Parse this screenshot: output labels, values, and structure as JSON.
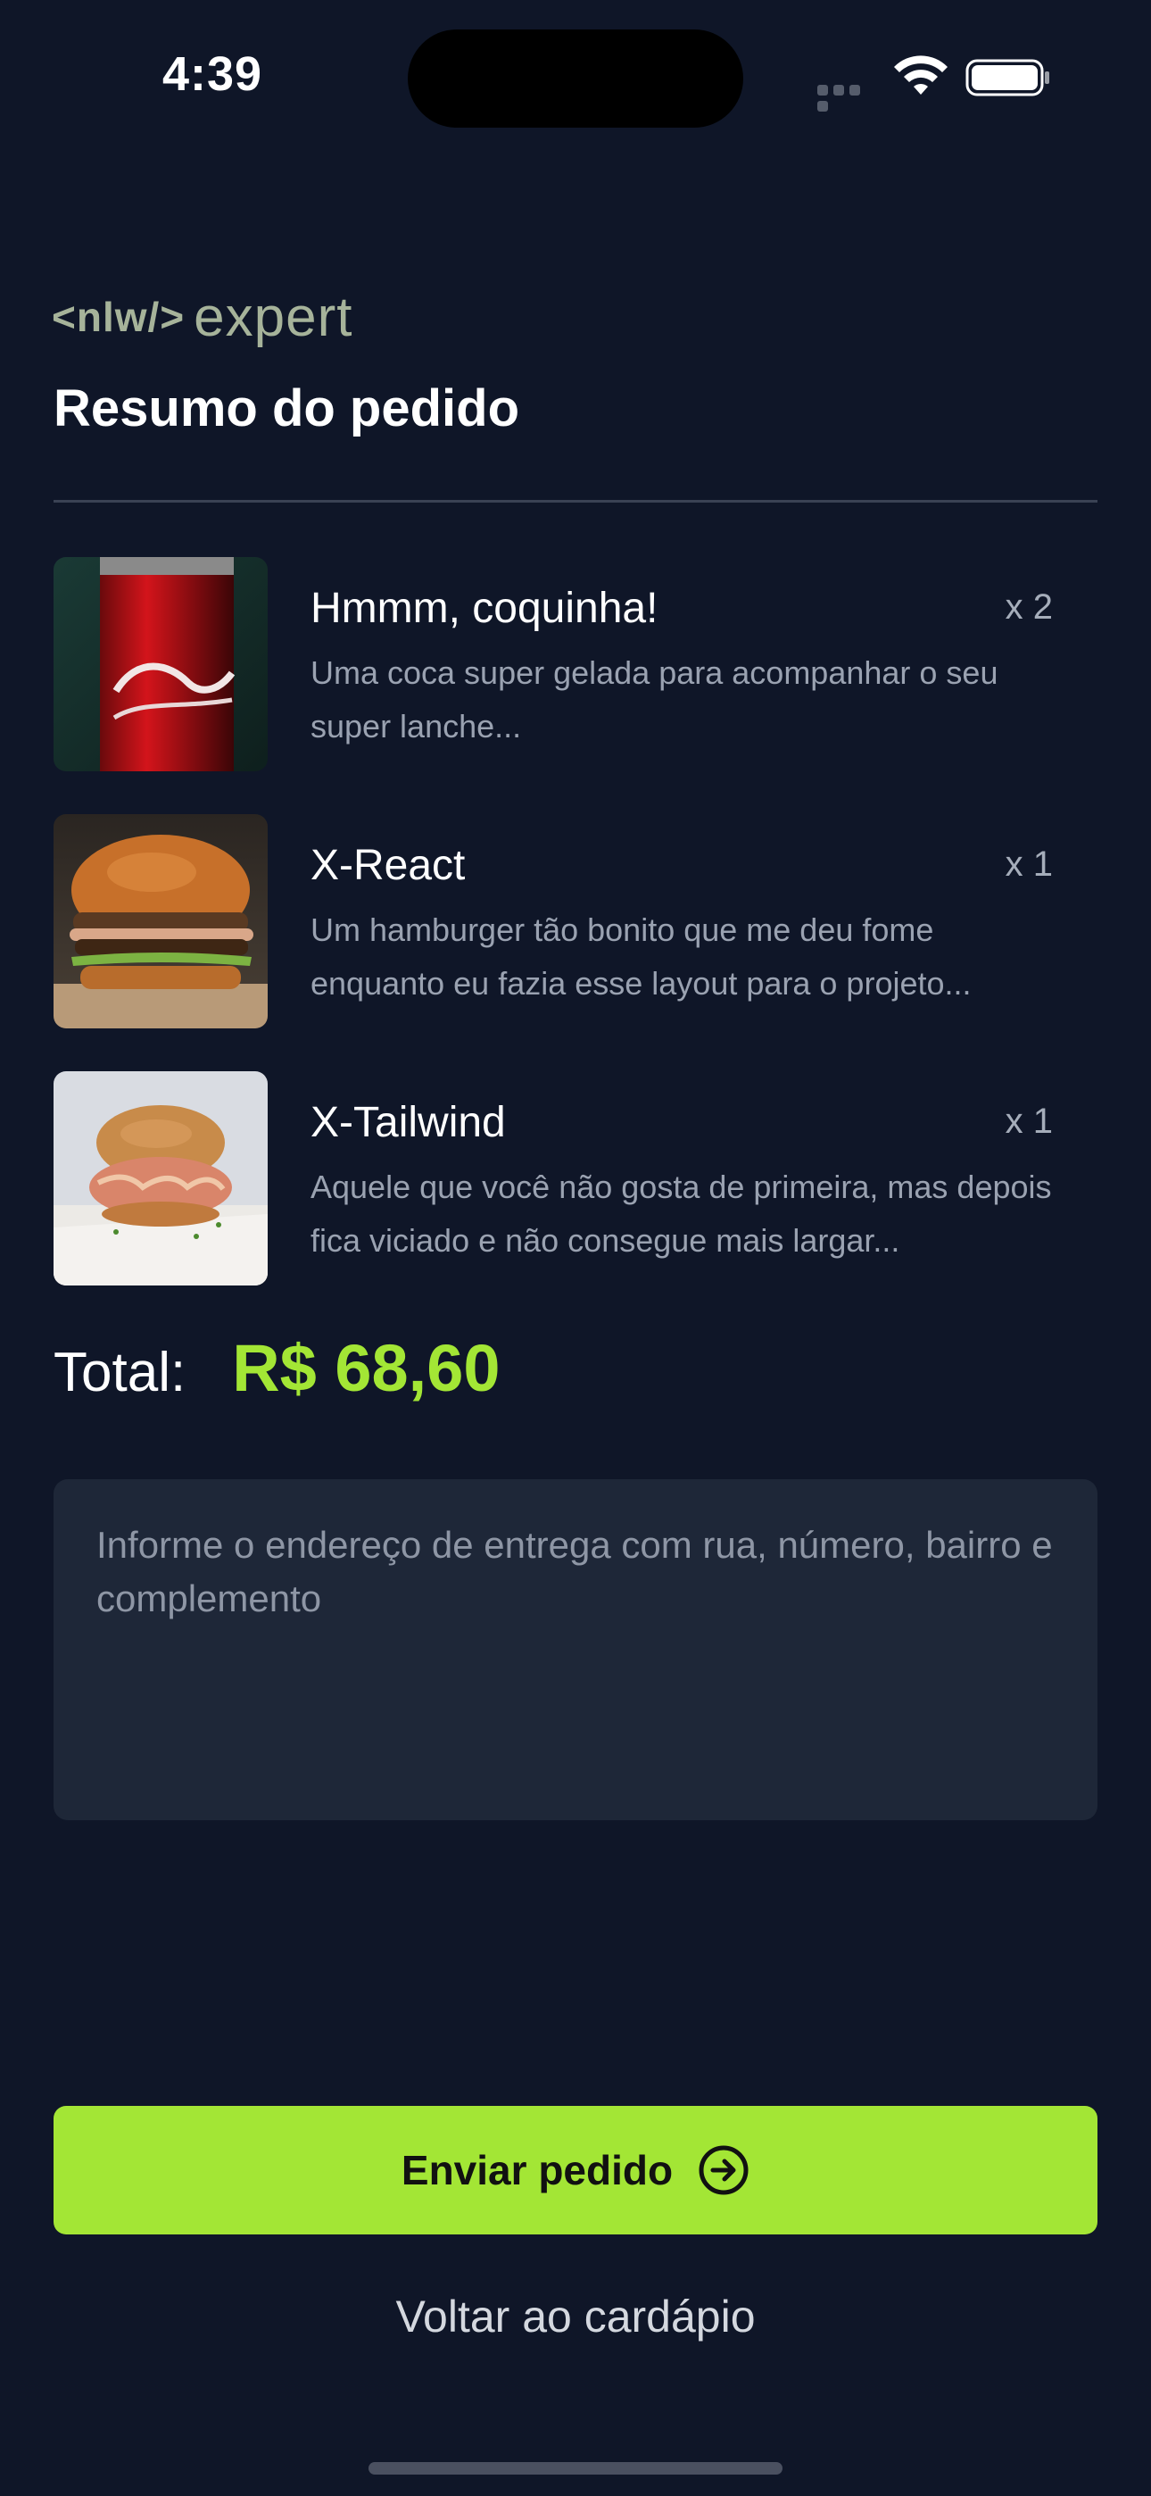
{
  "status_bar": {
    "time": "4:39"
  },
  "header": {
    "logo_nlw": "<nlw/>",
    "logo_expert": "expert",
    "title": "Resumo do pedido"
  },
  "items": [
    {
      "name": "Hmmm, coquinha!",
      "quantity": "x 2",
      "description": "Uma coca super gelada para acompanhar o seu super lanche...",
      "image_icon": "coca-cola-can"
    },
    {
      "name": "X-React",
      "quantity": "x 1",
      "description": "Um hamburger tão bonito que me deu fome enquanto eu fazia esse layout para o projeto...",
      "image_icon": "burger"
    },
    {
      "name": "X-Tailwind",
      "quantity": "x 1",
      "description": "Aquele que você não gosta de primeira, mas depois fica viciado e não consegue mais largar...",
      "image_icon": "pulled-pork-burger"
    }
  ],
  "total": {
    "label": "Total:",
    "value": "R$ 68,60"
  },
  "address": {
    "placeholder": "Informe o endereço de entrega com rua, número, bairro e complemento",
    "value": ""
  },
  "actions": {
    "send_label": "Enviar pedido",
    "back_label": "Voltar ao cardápio"
  },
  "colors": {
    "background": "#0f1628",
    "accent": "#a3e635",
    "input_background": "#1e2738",
    "muted_text": "#9aa2b1"
  }
}
